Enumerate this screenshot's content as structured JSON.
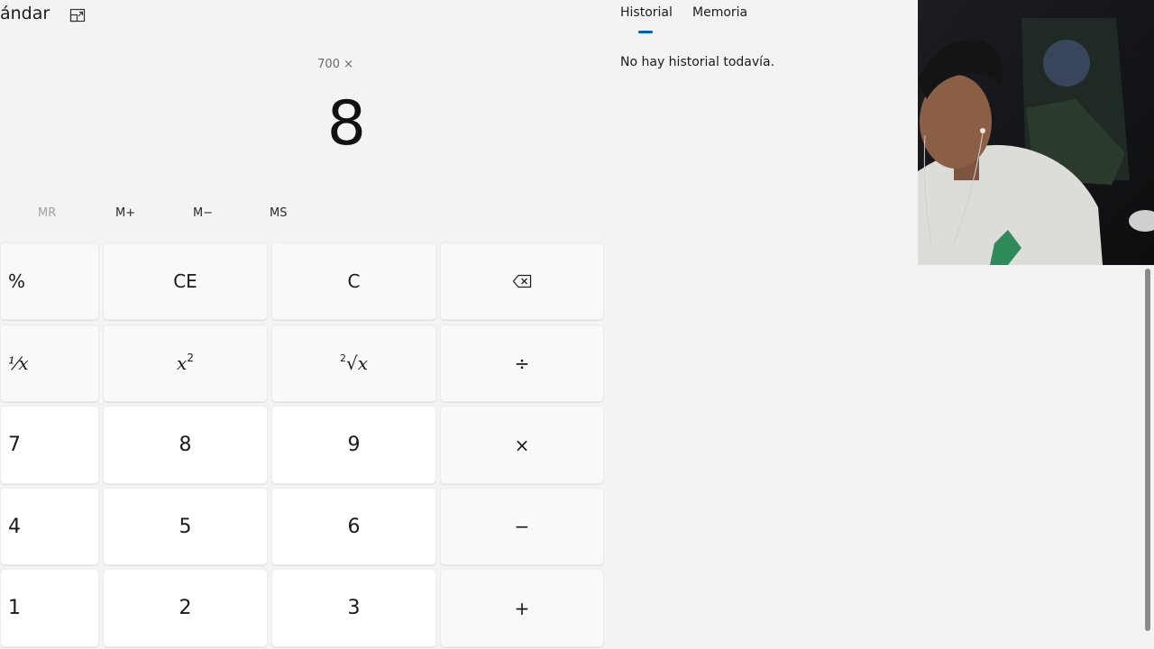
{
  "header": {
    "mode_title": "ándar"
  },
  "display": {
    "expression": "700 ×",
    "value": "8"
  },
  "memory": {
    "mr": "MR",
    "mplus": "M+",
    "mminus": "M−",
    "ms": "MS"
  },
  "keys": {
    "percent": "%",
    "ce": "CE",
    "c": "C",
    "reciprocal": "¹⁄x",
    "square_base": "x",
    "square_exp": "2",
    "root_index": "2",
    "root_symbol": "√",
    "root_x": "x",
    "divide": "÷",
    "multiply": "×",
    "minus": "−",
    "plus": "+",
    "d7": "7",
    "d8": "8",
    "d9": "9",
    "d4": "4",
    "d5": "5",
    "d6": "6",
    "d1": "1",
    "d2": "2",
    "d3": "3"
  },
  "history_panel": {
    "tab_history": "Historial",
    "tab_memory": "Memoria",
    "empty_text": "No hay historial todavía."
  },
  "colors": {
    "accent": "#005fb8",
    "background": "#f3f3f3"
  }
}
